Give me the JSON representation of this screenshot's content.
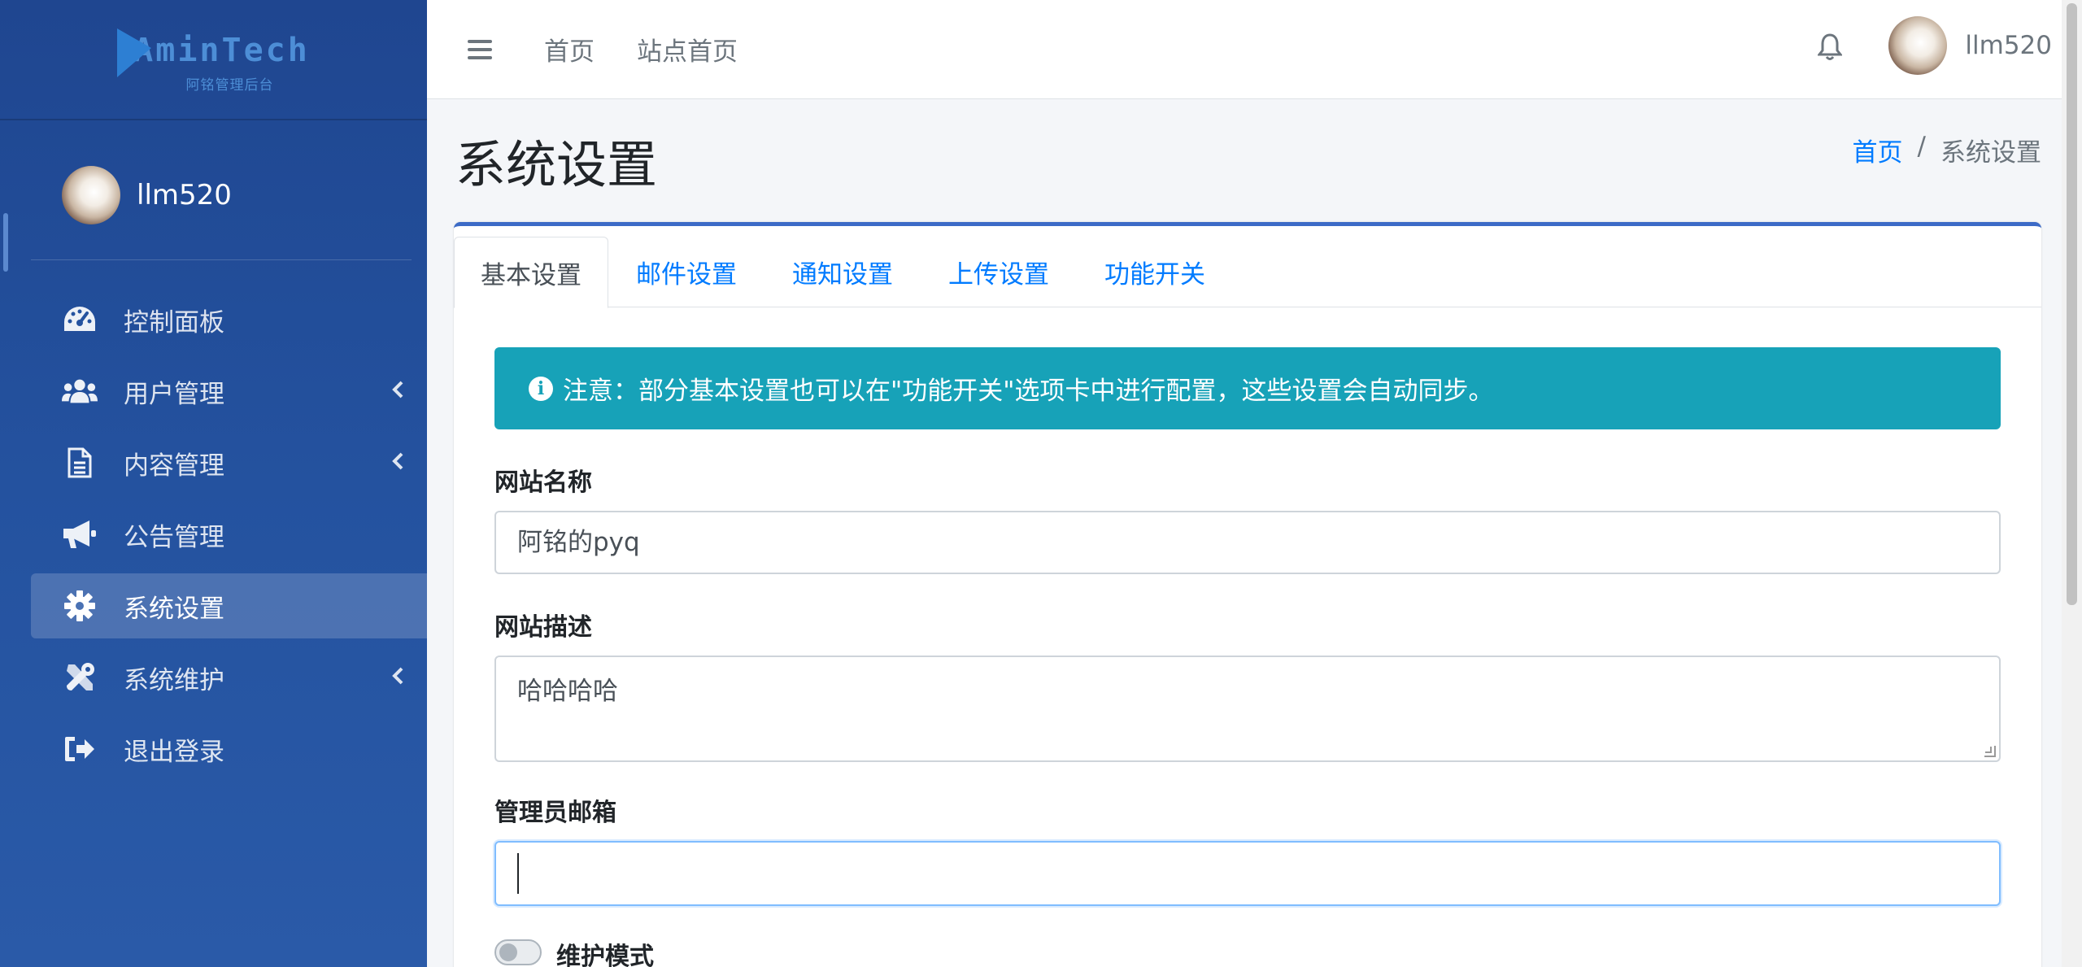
{
  "brand": {
    "logo_text": "AminTech",
    "logo_subtitle": "阿铭管理后台"
  },
  "sidebar": {
    "username": "llm520",
    "items": [
      {
        "label": "控制面板",
        "icon": "tachometer-icon",
        "has_caret": false,
        "active": false
      },
      {
        "label": "用户管理",
        "icon": "users-icon",
        "has_caret": true,
        "active": false
      },
      {
        "label": "内容管理",
        "icon": "file-text-icon",
        "has_caret": true,
        "active": false
      },
      {
        "label": "公告管理",
        "icon": "bullhorn-icon",
        "has_caret": false,
        "active": false
      },
      {
        "label": "系统设置",
        "icon": "gear-icon",
        "has_caret": false,
        "active": true
      },
      {
        "label": "系统维护",
        "icon": "tools-icon",
        "has_caret": true,
        "active": false
      },
      {
        "label": "退出登录",
        "icon": "sign-out-icon",
        "has_caret": false,
        "active": false
      }
    ]
  },
  "topbar": {
    "links": [
      "首页",
      "站点首页"
    ],
    "username": "llm520"
  },
  "header": {
    "title": "系统设置",
    "breadcrumb": {
      "home": "首页",
      "separator": "/",
      "current": "系统设置"
    }
  },
  "tabs": [
    "基本设置",
    "邮件设置",
    "通知设置",
    "上传设置",
    "功能开关"
  ],
  "alert": {
    "text": "注意：部分基本设置也可以在\"功能开关\"选项卡中进行配置，这些设置会自动同步。"
  },
  "form": {
    "site_name": {
      "label": "网站名称",
      "value": "阿铭的pyq"
    },
    "site_desc": {
      "label": "网站描述",
      "value": "哈哈哈哈"
    },
    "admin_email": {
      "label": "管理员邮箱",
      "value": ""
    },
    "maintenance": {
      "label": "维护模式",
      "enabled": false
    }
  },
  "colors": {
    "sidebar": "#24529f",
    "accent": "#3c6bc7",
    "alert": "#17a2b8",
    "link": "#007bff"
  }
}
